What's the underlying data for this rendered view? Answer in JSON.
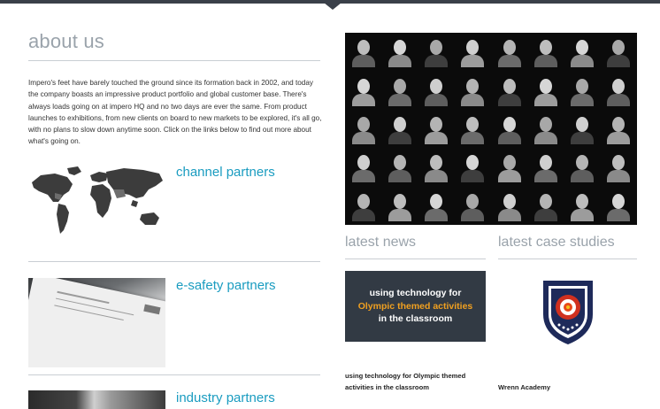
{
  "about": {
    "title": "about us",
    "paragraph": "Impero's feet have barely touched the ground since its formation back in 2002, and today the company boasts an impressive product portfolio and global customer base. There's always loads going on at impero HQ and no two days are ever the same. From product launches to exhibitions, from new clients on board to new markets to be explored, it's all go, with no plans to slow down anytime soon. Click on the links below to find out more about what's going on."
  },
  "partners": [
    {
      "label": "channel partners",
      "icon": "world-map-icon"
    },
    {
      "label": "e-safety partners",
      "icon": "document-photo"
    },
    {
      "label": "industry partners",
      "icon": "office-photo"
    }
  ],
  "news": {
    "title": "latest news",
    "box_line1": "using technology for",
    "box_highlight": "Olympic themed activities",
    "box_line2": "in the classroom",
    "caption": "using technology for Olympic themed activities in the classroom",
    "highlight_color": "#f0a020",
    "box_color": "#323a44"
  },
  "case_studies": {
    "title": "latest case studies",
    "caption": "Wrenn Academy",
    "crest_icon": "shield-rose-crest-icon"
  },
  "colors": {
    "accent": "#1a9cc0",
    "heading_gray": "#9aa3ab",
    "topbar": "#3a4049"
  }
}
